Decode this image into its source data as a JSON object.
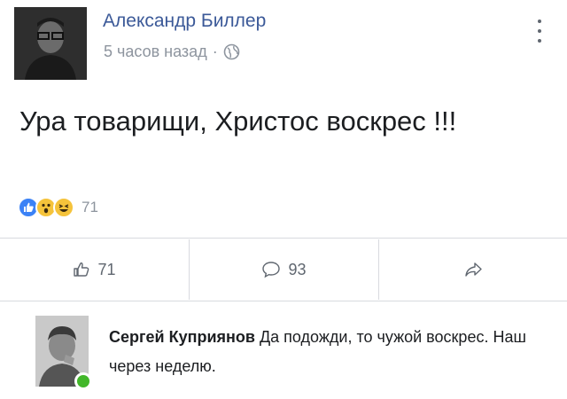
{
  "post": {
    "author": "Александр Биллер",
    "time": "5 часов назад",
    "meta_separator": "·",
    "text": "Ура товарищи, Христос воскрес !!!",
    "reactions_count": "71"
  },
  "actions": {
    "like_count": "71",
    "comment_count": "93"
  },
  "comment": {
    "author": "Сергей Куприянов",
    "text": "Да подожди, то чужой воскрес. Наш через неделю."
  },
  "colors": {
    "author_link": "#3b5998",
    "meta_gray": "#8d949e",
    "online": "#42b72a",
    "like_blue": "#3b82f6",
    "emoji_yellow": "#f5c33b"
  },
  "icons": [
    "globe-icon",
    "more-vertical-icon",
    "like-reaction-icon",
    "wow-reaction-icon",
    "haha-reaction-icon",
    "thumbs-up-icon",
    "comment-bubble-icon",
    "share-arrow-icon"
  ]
}
